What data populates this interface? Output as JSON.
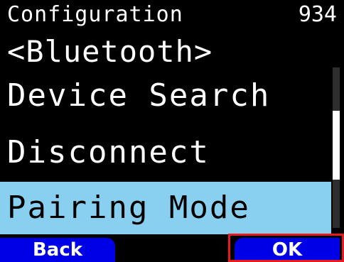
{
  "header": {
    "title": "Configuration",
    "number": "934"
  },
  "submenu": {
    "label": "<Bluetooth>"
  },
  "menu": {
    "items": [
      {
        "label": "Device Search",
        "selected": false
      },
      {
        "label": "Disconnect",
        "selected": false
      },
      {
        "label": "Pairing Mode",
        "selected": true
      }
    ]
  },
  "scrollbar": {
    "thumb_start_fraction": 0.27,
    "thumb_end_fraction": 0.7
  },
  "softkeys": {
    "back_label": "Back",
    "ok_label": "OK"
  },
  "colors": {
    "background": "#000000",
    "text": "#ffffff",
    "selection_background": "#89cff0",
    "softkey_background": "#0000e6",
    "callout_border": "#e8191f"
  }
}
